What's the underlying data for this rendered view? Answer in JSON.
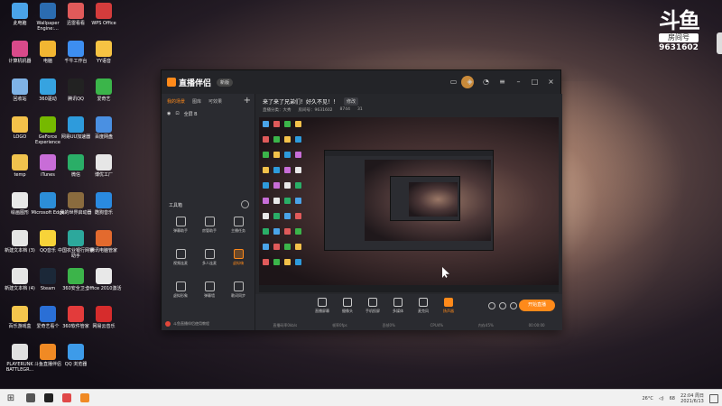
{
  "desktop": {
    "icons": [
      {
        "label": "此电脑",
        "color": "#4aa3e8",
        "col": 0,
        "row": 0
      },
      {
        "label": "Wallpaper Engine:...",
        "color": "#2b6cb0",
        "col": 1,
        "row": 0
      },
      {
        "label": "迅雷看看",
        "color": "#e05a5a",
        "col": 2,
        "row": 0
      },
      {
        "label": "WPS Office",
        "color": "#d43c3c",
        "col": 3,
        "row": 0
      },
      {
        "label": "计算机机器",
        "color": "#d94a8a",
        "col": 0,
        "row": 1
      },
      {
        "label": "电脑",
        "color": "#f2b632",
        "col": 1,
        "row": 1
      },
      {
        "label": "千牛工作台",
        "color": "#3d8ef0",
        "col": 2,
        "row": 1
      },
      {
        "label": "YY语音",
        "color": "#f6c343",
        "col": 3,
        "row": 1
      },
      {
        "label": "回收站",
        "color": "#7fb3e6",
        "col": 0,
        "row": 2
      },
      {
        "label": "360驱动",
        "color": "#36a3e0",
        "col": 1,
        "row": 2
      },
      {
        "label": "腾讯QQ",
        "color": "#222222",
        "col": 2,
        "row": 2
      },
      {
        "label": "爱奇艺",
        "color": "#3bb54a",
        "col": 3,
        "row": 2
      },
      {
        "label": "LOGO",
        "color": "#f3c14a",
        "col": 0,
        "row": 3
      },
      {
        "label": "GeForce Experience",
        "color": "#76b900",
        "col": 1,
        "row": 3
      },
      {
        "label": "网易UU加速器",
        "color": "#2e9bdc",
        "col": 2,
        "row": 3
      },
      {
        "label": "百度网盘",
        "color": "#4a90e2",
        "col": 3,
        "row": 3
      },
      {
        "label": "temp",
        "color": "#f0c24d",
        "col": 0,
        "row": 4
      },
      {
        "label": "iTunes",
        "color": "#c86dd7",
        "col": 1,
        "row": 4
      },
      {
        "label": "微信",
        "color": "#2aae67",
        "col": 2,
        "row": 4
      },
      {
        "label": "博优工厂",
        "color": "#e6e6e6",
        "col": 3,
        "row": 4
      },
      {
        "label": "绘画图形",
        "color": "#e8e8e8",
        "col": 0,
        "row": 5
      },
      {
        "label": "Microsoft Edge",
        "color": "#2c8ed8",
        "col": 1,
        "row": 5
      },
      {
        "label": "我的世界启动器",
        "color": "#8a6b3e",
        "col": 2,
        "row": 5
      },
      {
        "label": "酷狗音乐",
        "color": "#2a8ae0",
        "col": 3,
        "row": 5
      },
      {
        "label": "新建文本档 (3)",
        "color": "#e5e5e5",
        "col": 0,
        "row": 6
      },
      {
        "label": "QQ音乐",
        "color": "#f7d339",
        "col": 1,
        "row": 6
      },
      {
        "label": "中国农业银行网银助手",
        "color": "#2ca89c",
        "col": 2,
        "row": 6
      },
      {
        "label": "腾讯电脑管家",
        "color": "#e36a2e",
        "col": 3,
        "row": 6
      },
      {
        "label": "新建文本档 (4)",
        "color": "#e5e5e5",
        "col": 0,
        "row": 7
      },
      {
        "label": "Steam",
        "color": "#1b2838",
        "col": 1,
        "row": 7
      },
      {
        "label": "360安全卫士",
        "color": "#3cb44a",
        "col": 2,
        "row": 7
      },
      {
        "label": "Office 2010激活",
        "color": "#e8e8e8",
        "col": 3,
        "row": 7
      },
      {
        "label": "百乐游戏盒",
        "color": "#f4c64d",
        "col": 0,
        "row": 8
      },
      {
        "label": "爱奇艺看个",
        "color": "#2a6fd6",
        "col": 1,
        "row": 8
      },
      {
        "label": "360软件管家",
        "color": "#e33b3b",
        "col": 2,
        "row": 8
      },
      {
        "label": "网易云音乐",
        "color": "#d62c2c",
        "col": 3,
        "row": 8
      },
      {
        "label": "PLAYERUNK BATTLEGR...",
        "color": "#e0e0e0",
        "col": 0,
        "row": 9
      },
      {
        "label": "斗鱼直播伴侣",
        "color": "#f08a24",
        "col": 1,
        "row": 9
      },
      {
        "label": "QQ 浏览器",
        "color": "#3d9be9",
        "col": 2,
        "row": 9
      }
    ]
  },
  "room_badge": {
    "logo": "斗鱼",
    "room_label": "房间号",
    "room_number": "9631602"
  },
  "app": {
    "name": "直播伴侣",
    "version_pill": "新版",
    "left_tabs": [
      "我的场景",
      "图库",
      "可效果"
    ],
    "scene_label": "全屏 B",
    "tools_title": "工具箱",
    "tools": [
      {
        "label": "弹幕助手",
        "col": 0,
        "row": 0
      },
      {
        "label": "房管助手",
        "col": 1,
        "row": 0
      },
      {
        "label": "主播任务",
        "col": 2,
        "row": 0
      },
      {
        "label": "视频连麦",
        "col": 0,
        "row": 1
      },
      {
        "label": "多人连麦",
        "col": 1,
        "row": 1
      },
      {
        "label": "虚拟嗨",
        "col": 2,
        "row": 1
      },
      {
        "label": "虚拟形象",
        "col": 0,
        "row": 2
      },
      {
        "label": "弹幕墙",
        "col": 1,
        "row": 2
      },
      {
        "label": "歌词同步",
        "col": 2,
        "row": 2
      }
    ],
    "left_footer": "斗鱼直播伴侣使用教程",
    "stream_title": "来了来了兄弟们！好久不见！！",
    "edit_label": "修改",
    "meta": [
      "直播分类：大秀",
      "房间号：9631602",
      "8744",
      "31"
    ],
    "bottom_buttons": [
      {
        "label": "直播屏幕",
        "active": false
      },
      {
        "label": "摄像头",
        "active": false
      },
      {
        "label": "手机投屏",
        "active": false
      },
      {
        "label": "多媒体",
        "active": false
      },
      {
        "label": "麦克风",
        "active": false
      },
      {
        "label": "扬声器",
        "active": true
      }
    ],
    "start_button": "开始直播",
    "status_items": [
      "直播码率0kb/s",
      "帧率0fps",
      "丢帧0%",
      "CPU4%",
      "内存45%",
      "00:00:00"
    ]
  },
  "taskbar": {
    "start_icon": "windows-logo-icon",
    "pinned": [
      {
        "name": "task-view-icon",
        "color": "#555555"
      },
      {
        "name": "qq-icon",
        "color": "#222222"
      },
      {
        "name": "recorder-icon",
        "color": "#e04848"
      },
      {
        "name": "douyu-taskbar-icon",
        "color": "#f08a24"
      }
    ],
    "weather": "26°C",
    "clock_time": "22:04 周日",
    "clock_date": "2021/6/13",
    "tray_number": "68"
  }
}
